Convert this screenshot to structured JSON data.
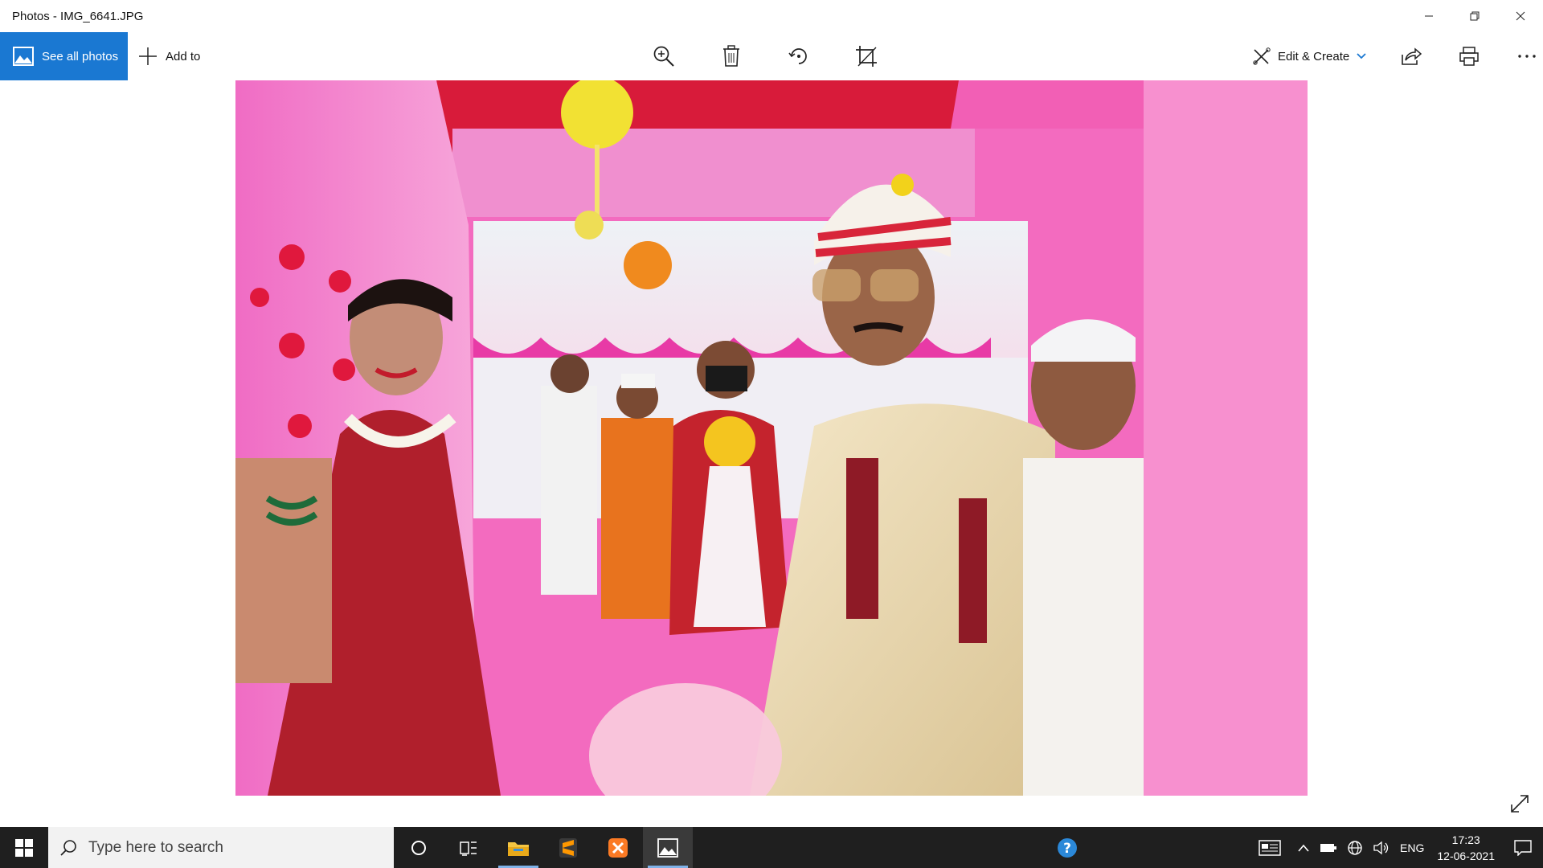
{
  "window": {
    "title": "Photos - IMG_6641.JPG"
  },
  "toolbar": {
    "see_all_photos": "See all photos",
    "add_to": "Add to",
    "edit_create": "Edit & Create"
  },
  "taskbar": {
    "search_placeholder": "Type here to search",
    "language": "ENG",
    "time": "17:23",
    "date": "12-06-2021"
  },
  "colors": {
    "accent": "#1a78d2",
    "taskbar": "#1f1f1f",
    "canopy_pink": "#f25fb5"
  },
  "icons": [
    "zoom-icon",
    "delete-icon",
    "rotate-icon",
    "crop-icon",
    "edit-create-icon",
    "share-icon",
    "print-icon",
    "more-icon",
    "expand-icon",
    "windows-start-icon",
    "search-icon",
    "cortana-icon",
    "task-view-icon",
    "file-explorer-icon",
    "sublime-text-icon",
    "xampp-icon",
    "photos-icon",
    "help-icon",
    "news-icon",
    "chevron-up-icon",
    "battery-icon",
    "network-icon",
    "volume-icon",
    "notification-icon"
  ]
}
